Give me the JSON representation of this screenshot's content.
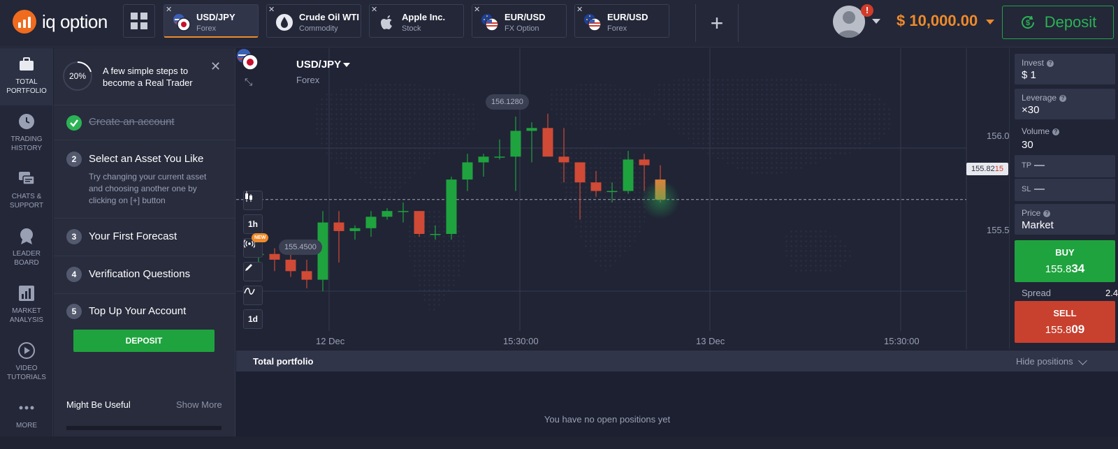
{
  "brand": {
    "name": "iq option",
    "accent": "#ef6b1e"
  },
  "tabs": [
    {
      "name": "USD/JPY",
      "sub": "Forex",
      "icon": "usd-jpy-flag-icon",
      "active": true
    },
    {
      "name": "Crude Oil WTI",
      "sub": "Commodity",
      "icon": "oil-drop-icon"
    },
    {
      "name": "Apple Inc.",
      "sub": "Stock",
      "icon": "apple-icon"
    },
    {
      "name": "EUR/USD",
      "sub": "FX Option",
      "icon": "eur-usd-flag-icon"
    },
    {
      "name": "EUR/USD",
      "sub": "Forex",
      "icon": "eur-usd-flag-icon"
    }
  ],
  "header": {
    "notification_badge": "!",
    "balance": "$ 10,000.00",
    "deposit_label": "Deposit"
  },
  "sidenav": [
    {
      "label1": "TOTAL",
      "label2": "PORTFOLIO",
      "icon": "briefcase-icon"
    },
    {
      "label1": "TRADING",
      "label2": "HISTORY",
      "icon": "clock-icon"
    },
    {
      "label1": "CHATS &",
      "label2": "SUPPORT",
      "icon": "chat-icon"
    },
    {
      "label1": "LEADER",
      "label2": "BOARD",
      "icon": "medal-icon"
    },
    {
      "label1": "MARKET",
      "label2": "ANALYSIS",
      "icon": "bar-chart-icon"
    },
    {
      "label1": "VIDEO",
      "label2": "TUTORIALS",
      "icon": "play-icon"
    },
    {
      "label1": "MORE",
      "label2": "",
      "icon": "more-dots-icon"
    }
  ],
  "steps_panel": {
    "progress": "20%",
    "progress_value": 0.2,
    "heading": "A few simple steps to become a Real Trader",
    "steps": [
      {
        "title": "Create an account",
        "done": true
      },
      {
        "num": "2",
        "title": "Select an Asset You Like",
        "desc": "Try changing your current asset and choosing another one by clicking on [+] button"
      },
      {
        "num": "3",
        "title": "Your First Forecast"
      },
      {
        "num": "4",
        "title": "Verification Questions"
      },
      {
        "num": "5",
        "title": "Top Up Your Account"
      }
    ],
    "deposit_button": "DEPOSIT",
    "might_be_useful": "Might Be Useful",
    "show_more": "Show More"
  },
  "chart": {
    "asset": "USD/JPY",
    "asset_type": "Forex",
    "tool_buttons": [
      "1h",
      "1d"
    ],
    "new_badge": "NEW",
    "current_price_main": "155.82",
    "current_price_tail": "15",
    "high_bubble": "156.1280",
    "low_bubble": "155.4500",
    "y_ticks": [
      "156.0",
      "155.5"
    ],
    "x_ticks": [
      "12 Dec",
      "15:30:00",
      "13 Dec",
      "15:30:00"
    ],
    "colors": {
      "up": "#1fa33e",
      "down": "#d04a35"
    }
  },
  "chart_data": {
    "type": "candlestick",
    "title": "USD/JPY",
    "ylim": [
      155.3,
      156.3
    ],
    "candles": [
      {
        "o": 155.63,
        "h": 155.7,
        "l": 155.55,
        "c": 155.63
      },
      {
        "o": 155.63,
        "h": 155.65,
        "l": 155.57,
        "c": 155.61
      },
      {
        "o": 155.61,
        "h": 155.63,
        "l": 155.55,
        "c": 155.57
      },
      {
        "o": 155.57,
        "h": 155.61,
        "l": 155.51,
        "c": 155.54
      },
      {
        "o": 155.54,
        "h": 155.78,
        "l": 155.5,
        "c": 155.74
      },
      {
        "o": 155.74,
        "h": 155.78,
        "l": 155.6,
        "c": 155.71
      },
      {
        "o": 155.71,
        "h": 155.73,
        "l": 155.68,
        "c": 155.72
      },
      {
        "o": 155.72,
        "h": 155.78,
        "l": 155.69,
        "c": 155.76
      },
      {
        "o": 155.76,
        "h": 155.79,
        "l": 155.75,
        "c": 155.78
      },
      {
        "o": 155.78,
        "h": 155.81,
        "l": 155.74,
        "c": 155.78
      },
      {
        "o": 155.78,
        "h": 155.78,
        "l": 155.69,
        "c": 155.7
      },
      {
        "o": 155.7,
        "h": 155.73,
        "l": 155.68,
        "c": 155.7
      },
      {
        "o": 155.7,
        "h": 155.9,
        "l": 155.68,
        "c": 155.89
      },
      {
        "o": 155.89,
        "h": 155.98,
        "l": 155.85,
        "c": 155.95
      },
      {
        "o": 155.95,
        "h": 155.98,
        "l": 155.9,
        "c": 155.97
      },
      {
        "o": 155.97,
        "h": 156.03,
        "l": 155.96,
        "c": 155.97
      },
      {
        "o": 155.97,
        "h": 156.11,
        "l": 155.85,
        "c": 156.06
      },
      {
        "o": 156.06,
        "h": 156.09,
        "l": 155.95,
        "c": 156.07
      },
      {
        "o": 156.07,
        "h": 156.12,
        "l": 155.98,
        "c": 155.97
      },
      {
        "o": 155.97,
        "h": 156.07,
        "l": 155.88,
        "c": 155.95
      },
      {
        "o": 155.95,
        "h": 155.95,
        "l": 155.75,
        "c": 155.88
      },
      {
        "o": 155.88,
        "h": 155.92,
        "l": 155.83,
        "c": 155.85
      },
      {
        "o": 155.85,
        "h": 155.88,
        "l": 155.81,
        "c": 155.85
      },
      {
        "o": 155.85,
        "h": 155.99,
        "l": 155.84,
        "c": 155.96
      },
      {
        "o": 155.96,
        "h": 155.98,
        "l": 155.85,
        "c": 155.94
      },
      {
        "o": 155.89,
        "h": 155.94,
        "l": 155.81,
        "c": 155.82
      }
    ]
  },
  "trade_panel": {
    "invest_label": "Invest",
    "invest_value": "$ 1",
    "leverage_label": "Leverage",
    "leverage_value": "×30",
    "volume_label": "Volume",
    "volume_value": "30",
    "tp_label": "TP",
    "tp_value": "—",
    "sl_label": "SL",
    "sl_value": "—",
    "price_label": "Price",
    "price_value": "Market",
    "buy_label": "BUY",
    "buy_price_main": "155.8",
    "buy_price_tail": "34",
    "spread_label": "Spread",
    "spread_value": "2.4",
    "sell_label": "SELL",
    "sell_price_main": "155.8",
    "sell_price_tail": "09",
    "help_mark": "?"
  },
  "portfolio": {
    "title": "Total portfolio",
    "hide_label": "Hide positions",
    "empty_message": "You have no open positions yet"
  }
}
